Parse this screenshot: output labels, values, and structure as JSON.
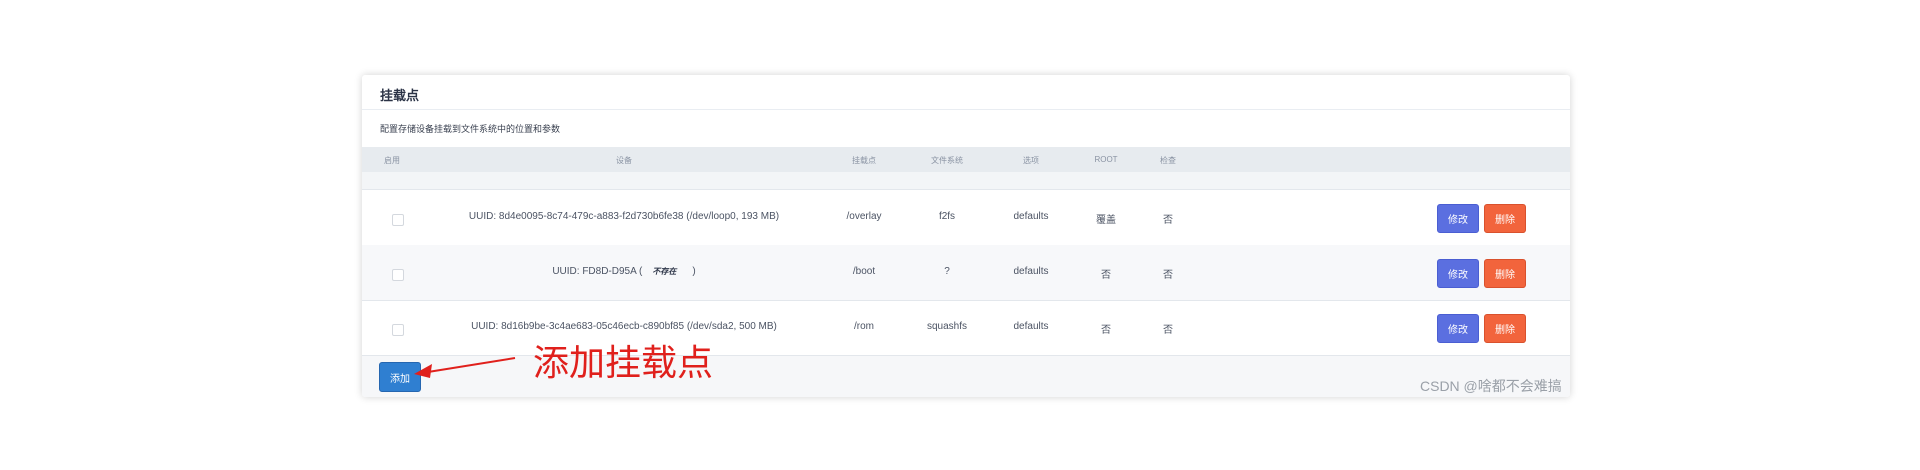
{
  "panel": {
    "title": "挂载点",
    "description": "配置存储设备挂载到文件系统中的位置和参数"
  },
  "table": {
    "headers": {
      "enable": "启用",
      "device": "设备",
      "mountpoint": "挂载点",
      "filesystem": "文件系统",
      "options": "选项",
      "root": "ROOT",
      "check": "检查"
    },
    "rows": [
      {
        "device": "UUID: 8d4e0095-8c74-479c-a883-f2d730b6fe38 (/dev/loop0, 193 MB)",
        "mountpoint": "/overlay",
        "filesystem": "f2fs",
        "options": "defaults",
        "root": "覆盖",
        "check": "否",
        "edit_label": "修改",
        "delete_label": "删除"
      },
      {
        "device_prefix": "UUID: FD8D-D95A (",
        "device_tag": "不存在",
        "device_suffix": ")",
        "mountpoint": "/boot",
        "filesystem": "?",
        "options": "defaults",
        "root": "否",
        "check": "否",
        "edit_label": "修改",
        "delete_label": "删除"
      },
      {
        "device": "UUID: 8d16b9be-3c4ae683-05c46ecb-c890bf85 (/dev/sda2, 500 MB)",
        "mountpoint": "/rom",
        "filesystem": "squashfs",
        "options": "defaults",
        "root": "否",
        "check": "否",
        "edit_label": "修改",
        "delete_label": "删除"
      }
    ]
  },
  "footer": {
    "add_label": "添加"
  },
  "annotation": {
    "text": "添加挂载点",
    "color": "#e0201c"
  },
  "watermark": "CSDN @啥都不会难搞",
  "colors": {
    "edit_button": "#5b6fe0",
    "delete_button": "#f2643c",
    "add_button": "#2f7fd1"
  }
}
